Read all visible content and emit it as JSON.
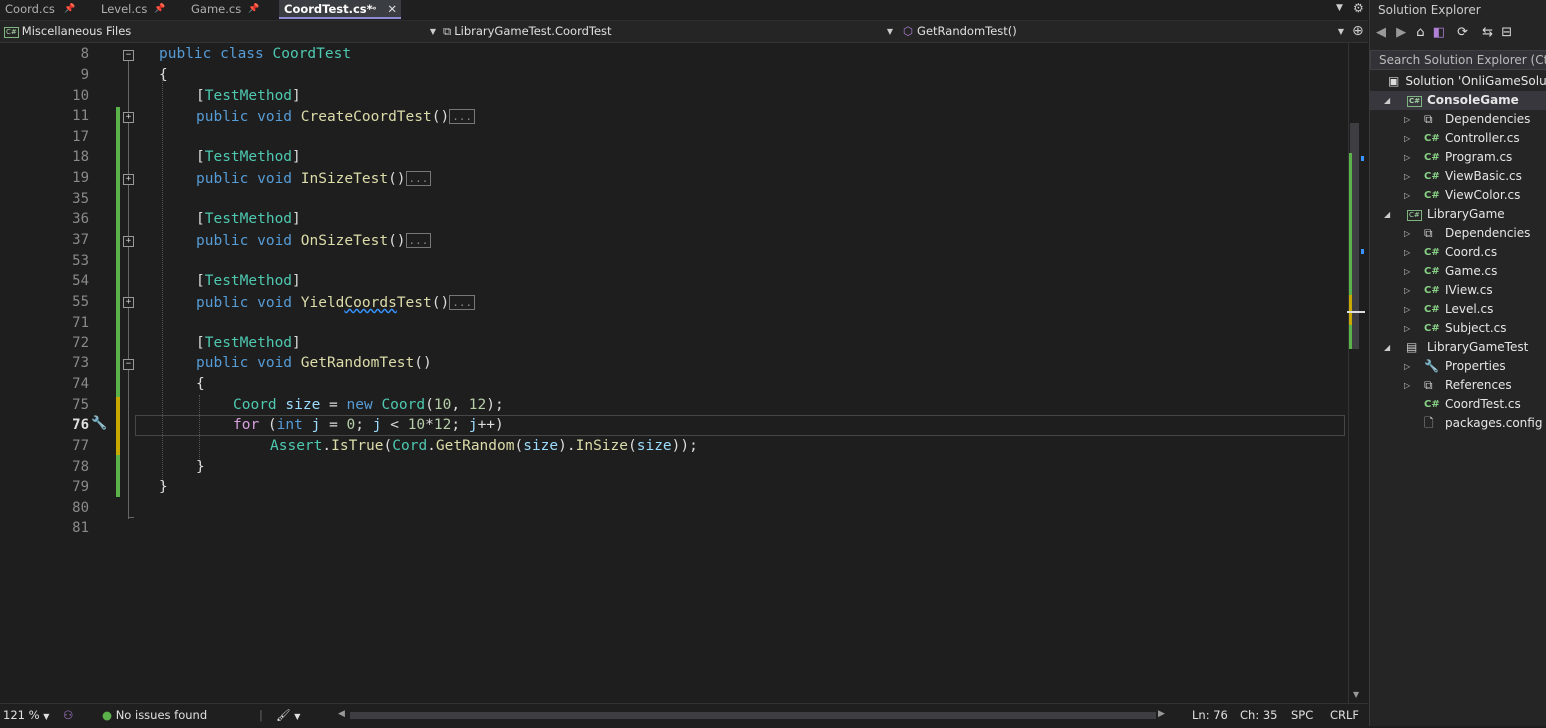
{
  "tabs": [
    {
      "label": "Coord.cs"
    },
    {
      "label": "Level.cs"
    },
    {
      "label": "Game.cs"
    },
    {
      "label": "CoordTest.cs*"
    }
  ],
  "navbar": {
    "project": "Miscellaneous Files",
    "type": "LibraryGameTest.CoordTest",
    "member": "GetRandomTest()"
  },
  "editor": {
    "line_numbers": [
      "8",
      "9",
      "10",
      "11",
      "17",
      "18",
      "19",
      "35",
      "36",
      "37",
      "53",
      "54",
      "55",
      "71",
      "72",
      "73",
      "74",
      "75",
      "76",
      "77",
      "78",
      "79",
      "80",
      "81"
    ],
    "current_line": "76"
  },
  "solution_explorer": {
    "title": "Solution Explorer",
    "search_placeholder": "Search Solution Explorer (Ctrl+;)",
    "solution": "Solution 'OnliGameSolution'",
    "items": [
      {
        "label": "ConsoleGame"
      },
      {
        "label": "Dependencies"
      },
      {
        "label": "Controller.cs"
      },
      {
        "label": "Program.cs"
      },
      {
        "label": "ViewBasic.cs"
      },
      {
        "label": "ViewColor.cs"
      },
      {
        "label": "LibraryGame"
      },
      {
        "label": "Dependencies"
      },
      {
        "label": "Coord.cs"
      },
      {
        "label": "Game.cs"
      },
      {
        "label": "IView.cs"
      },
      {
        "label": "Level.cs"
      },
      {
        "label": "Subject.cs"
      },
      {
        "label": "LibraryGameTest"
      },
      {
        "label": "Properties"
      },
      {
        "label": "References"
      },
      {
        "label": "CoordTest.cs"
      },
      {
        "label": "packages.config"
      }
    ]
  },
  "status": {
    "zoom": "121 %",
    "issues": "No issues found",
    "line": "Ln: 76",
    "col": "Ch: 35",
    "whitespace": "SPC",
    "eol": "CRLF"
  },
  "colors": {
    "accent": "#8e8cd8",
    "change_bar": "#5bb14a",
    "keyword": "#569cd6",
    "type": "#4ec9b0",
    "method": "#dcdcaa"
  }
}
